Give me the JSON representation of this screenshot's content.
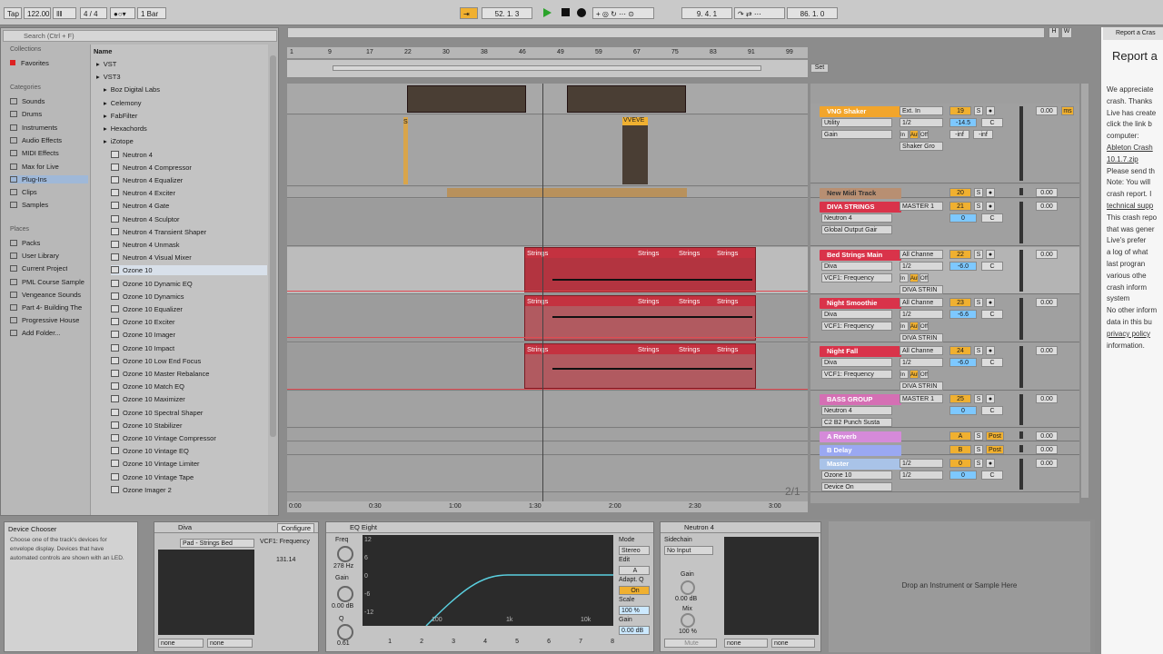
{
  "transport": {
    "tap": "Tap",
    "tempo": "122.00",
    "signature": "4 / 4",
    "quantize": "1 Bar",
    "position": "52. 1. 3",
    "loop_start": "9. 4. 1",
    "loop_length": "86. 1. 0"
  },
  "browser": {
    "search_placeholder": "Search (Ctrl + F)",
    "collections_title": "Collections",
    "favorites": "Favorites",
    "categories_title": "Categories",
    "categories": [
      "Sounds",
      "Drums",
      "Instruments",
      "Audio Effects",
      "MIDI Effects",
      "Max for Live",
      "Plug-Ins",
      "Clips",
      "Samples"
    ],
    "places_title": "Places",
    "places": [
      "Packs",
      "User Library",
      "Current Project",
      "PML Course Sample",
      "Vengeance Sounds",
      "Part 4- Building The",
      "Progressive House",
      "Add Folder..."
    ],
    "name_header": "Name",
    "folders": [
      "VST",
      "VST3",
      "Boz Digital Labs",
      "Celemony",
      "FabFilter",
      "Hexachords",
      "iZotope"
    ],
    "plugins": [
      "Neutron 4",
      "Neutron 4 Compressor",
      "Neutron 4 Equalizer",
      "Neutron 4 Exciter",
      "Neutron 4 Gate",
      "Neutron 4 Sculptor",
      "Neutron 4 Transient Shaper",
      "Neutron 4 Unmask",
      "Neutron 4 Visual Mixer",
      "Ozone 10",
      "Ozone 10 Dynamic EQ",
      "Ozone 10 Dynamics",
      "Ozone 10 Equalizer",
      "Ozone 10 Exciter",
      "Ozone 10 Imager",
      "Ozone 10 Impact",
      "Ozone 10 Low End Focus",
      "Ozone 10 Master Rebalance",
      "Ozone 10 Match EQ",
      "Ozone 10 Maximizer",
      "Ozone 10 Spectral Shaper",
      "Ozone 10 Stabilizer",
      "Ozone 10 Vintage Compressor",
      "Ozone 10 Vintage EQ",
      "Ozone 10 Vintage Limiter",
      "Ozone 10 Vintage Tape",
      "Ozone Imager 2"
    ]
  },
  "ruler": {
    "bars": [
      "1",
      "9",
      "17",
      "22",
      "30",
      "38",
      "46",
      "49",
      "59",
      "67",
      "75",
      "83",
      "91",
      "99"
    ],
    "times": [
      "0:00",
      "0:30",
      "1:00",
      "1:30",
      "2:00",
      "2:30",
      "3:00"
    ],
    "page": "2/1",
    "set_label": "Set"
  },
  "clips": {
    "vve": "VVEVE",
    "s": "S",
    "strings": "Strings"
  },
  "tracks": [
    {
      "name": "VNG Shaker",
      "color": "#f2a52b",
      "devices": [
        "Utility",
        "Gain"
      ],
      "io": [
        "Ext. In",
        "1/2",
        "In",
        "Auto",
        "Off",
        "Shaker Gro"
      ],
      "num": "19",
      "vol": "-14.5",
      "pan": "C",
      "send": "0.00",
      "ms": "ms",
      "inf": "-inf"
    },
    {
      "name": "New Midi Track",
      "color": "#b88f72",
      "num": "20",
      "send": "0.00"
    },
    {
      "name": "DIVA STRINGS",
      "color": "#d9334a",
      "devices": [
        "Neutron 4",
        "Global Output Gair"
      ],
      "io": [
        "MASTER 1"
      ],
      "num": "21",
      "vol": "0",
      "pan": "C",
      "send": "0.00"
    },
    {
      "name": "Bed Strings Main",
      "color": "#d9334a",
      "devices": [
        "Diva",
        "VCF1: Frequency"
      ],
      "io": [
        "All Channe",
        "1/2",
        "In",
        "Auto",
        "Off",
        "DIVA STRIN"
      ],
      "num": "22",
      "vol": "-6.0",
      "pan": "C",
      "send": "0.00"
    },
    {
      "name": "Night Smoothie",
      "color": "#d9334a",
      "devices": [
        "Diva",
        "VCF1: Frequency"
      ],
      "io": [
        "All Channe",
        "1/2",
        "In",
        "Auto",
        "Off",
        "DIVA STRIN"
      ],
      "num": "23",
      "vol": "-6.6",
      "pan": "C",
      "send": "0.00"
    },
    {
      "name": "Night Fall",
      "color": "#d9334a",
      "devices": [
        "Diva",
        "VCF1: Frequency"
      ],
      "io": [
        "All Channe",
        "1/2",
        "In",
        "Auto",
        "Off",
        "DIVA STRIN"
      ],
      "num": "24",
      "vol": "-6.0",
      "pan": "C",
      "send": "0.00"
    },
    {
      "name": "BASS GROUP",
      "color": "#d56fb4",
      "devices": [
        "Neutron 4",
        "C2 B2 Punch Susta"
      ],
      "io": [
        "MASTER 1"
      ],
      "num": "25",
      "vol": "0",
      "pan": "C",
      "send": "0.00"
    },
    {
      "name": "A Reverb",
      "color": "#d58ad9",
      "num": "A",
      "post": "Post",
      "send": "0.00"
    },
    {
      "name": "B Delay",
      "color": "#9aa8f2",
      "num": "B",
      "post": "Post",
      "send": "0.00"
    },
    {
      "name": "Master",
      "color": "#a9c3e8",
      "devices": [
        "Ozone 10",
        "Device On"
      ],
      "io": [
        "1/2",
        "1/2"
      ],
      "num": "0",
      "vol": "0",
      "pan": "C",
      "send": "0.00"
    }
  ],
  "chooser": {
    "title": "Device Chooser",
    "text": "Choose one of the track's devices for envelope display. Devices that have automated controls are shown with an LED."
  },
  "diva": {
    "title": "Diva",
    "configure": "Configure",
    "preset": "Pad - Strings Bed",
    "param": "VCF1: Frequency",
    "value": "131.14",
    "none1": "none",
    "none2": "none"
  },
  "eq": {
    "title": "EQ Eight",
    "freq_label": "Freq",
    "freq": "278 Hz",
    "gain_label": "Gain",
    "gain": "0.00 dB",
    "q_label": "Q",
    "q": "0.61",
    "db_ticks": [
      "12",
      "6",
      "0",
      "-6",
      "-12"
    ],
    "hz_ticks": [
      "100",
      "1k",
      "10k"
    ],
    "mode_label": "Mode",
    "mode": "Stereo",
    "edit_label": "Edit",
    "edit": "A",
    "adapt_label": "Adapt. Q",
    "adapt": "On",
    "scale_label": "Scale",
    "scale": "100 %",
    "gain2_label": "Gain",
    "gain2": "0.00 dB",
    "bands": [
      "1",
      "2",
      "3",
      "4",
      "5",
      "6",
      "7",
      "8"
    ]
  },
  "neutron": {
    "title": "Neutron 4",
    "sidechain": "Sidechain",
    "no_input": "No Input",
    "gain_label": "Gain",
    "gain": "0.00 dB",
    "mix_label": "Mix",
    "mix": "100 %",
    "mute": "Mute",
    "none1": "none",
    "none2": "none"
  },
  "drop_text": "Drop an Instrument or Sample Here",
  "crash": {
    "tab": "Report a Cras",
    "title": "Report a",
    "lines": [
      "We appreciate",
      "crash. Thanks",
      "Live has create",
      "click the link b",
      "computer:",
      "Ableton Crash",
      "10.1.7.zip",
      "Please send th",
      "Note: You will",
      "crash report. I",
      "technical supp",
      "This crash repo",
      "that was gener",
      "Live's prefer",
      "a log of what",
      "last progran",
      "various othe",
      "crash inform",
      "system",
      "No other inform",
      "data in this bu",
      "privacy policy",
      "information."
    ]
  }
}
